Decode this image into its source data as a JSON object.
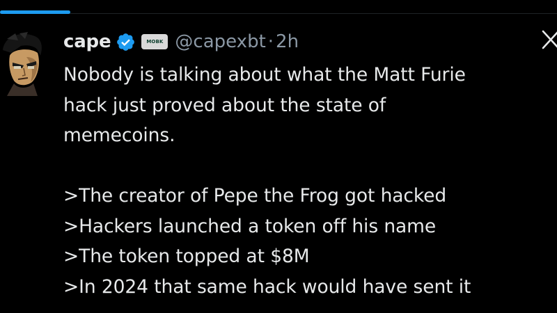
{
  "app": {
    "accent_color": "#1d9bf0",
    "background_color": "#000000"
  },
  "tweet": {
    "author": {
      "display_name": "cape",
      "handle": "@capexbt",
      "verified": true,
      "verified_icon": "verified-badge-icon",
      "affiliate_badge_text": "MOBK"
    },
    "separator": "·",
    "time": "2h",
    "close_icon": "close-icon",
    "text": {
      "paragraph_1": [
        "Nobody is talking about what the Matt Furie",
        "hack just proved about the state of",
        "memecoins."
      ],
      "lines": [
        ">The creator of Pepe the Frog got hacked",
        ">Hackers launched a token off his name",
        ">The token topped at $8M",
        ">In 2024 that same hack would have sent it"
      ]
    }
  }
}
